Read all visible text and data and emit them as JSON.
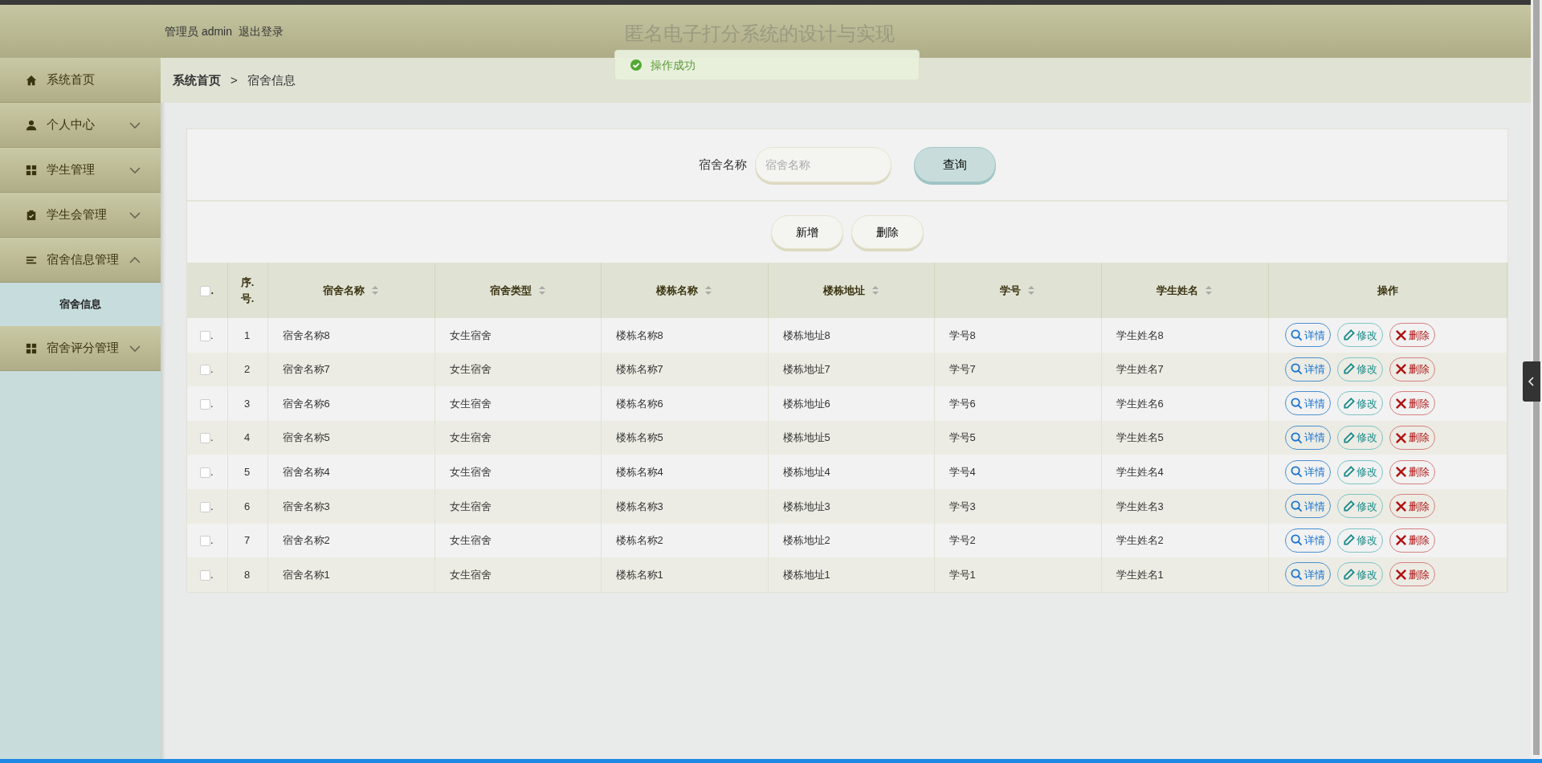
{
  "header": {
    "role": "管理员",
    "username": "admin",
    "logout": "退出登录",
    "title": "匿名电子打分系统的设计与实现"
  },
  "toast": {
    "kind": "success",
    "text": "操作成功"
  },
  "sidebar": {
    "items": [
      {
        "label": "系统首页",
        "kind": "link"
      },
      {
        "label": "个人中心",
        "kind": "menu",
        "expanded": false
      },
      {
        "label": "学生管理",
        "kind": "menu",
        "expanded": false
      },
      {
        "label": "学生会管理",
        "kind": "menu",
        "expanded": false
      },
      {
        "label": "宿舍信息管理",
        "kind": "menu",
        "expanded": true,
        "children": [
          {
            "label": "宿舍信息",
            "selected": true
          }
        ]
      },
      {
        "label": "宿舍评分管理",
        "kind": "menu",
        "expanded": false
      }
    ]
  },
  "breadcrumb": {
    "items": [
      "系统首页",
      "宿舍信息"
    ],
    "separator": ">"
  },
  "search": {
    "label": "宿舍名称",
    "placeholder": "宿舍名称",
    "button": "查询"
  },
  "actions": [
    "新增",
    "删除"
  ],
  "table": {
    "checkbox_suffix": ".",
    "all_checked": false,
    "columns": [
      {
        "label": "序.\n号.",
        "sortable": false
      },
      {
        "label": "宿舍名称",
        "sortable": true
      },
      {
        "label": "宿舍类型",
        "sortable": true
      },
      {
        "label": "楼栋名称",
        "sortable": true
      },
      {
        "label": "楼栋地址",
        "sortable": true
      },
      {
        "label": "学号",
        "sortable": true
      },
      {
        "label": "学生姓名",
        "sortable": true
      },
      {
        "label": "操作",
        "sortable": false
      }
    ],
    "rows": [
      {
        "checked": false,
        "cells": [
          "1",
          "宿舍名称8",
          "女生宿舍",
          "楼栋名称8",
          "楼栋地址8",
          "学号8",
          "学生姓名8"
        ],
        "buttons": [
          {
            "kind": "detail",
            "label": "详情"
          },
          {
            "kind": "edit",
            "label": "修改"
          },
          {
            "kind": "delete",
            "label": "删除"
          }
        ]
      },
      {
        "checked": false,
        "cells": [
          "2",
          "宿舍名称7",
          "女生宿舍",
          "楼栋名称7",
          "楼栋地址7",
          "学号7",
          "学生姓名7"
        ],
        "buttons": [
          {
            "kind": "detail",
            "label": "详情"
          },
          {
            "kind": "edit",
            "label": "修改"
          },
          {
            "kind": "delete",
            "label": "删除"
          }
        ]
      },
      {
        "checked": false,
        "cells": [
          "3",
          "宿舍名称6",
          "女生宿舍",
          "楼栋名称6",
          "楼栋地址6",
          "学号6",
          "学生姓名6"
        ],
        "buttons": [
          {
            "kind": "detail",
            "label": "详情"
          },
          {
            "kind": "edit",
            "label": "修改"
          },
          {
            "kind": "delete",
            "label": "删除"
          }
        ]
      },
      {
        "checked": false,
        "cells": [
          "4",
          "宿舍名称5",
          "女生宿舍",
          "楼栋名称5",
          "楼栋地址5",
          "学号5",
          "学生姓名5"
        ],
        "buttons": [
          {
            "kind": "detail",
            "label": "详情"
          },
          {
            "kind": "edit",
            "label": "修改"
          },
          {
            "kind": "delete",
            "label": "删除"
          }
        ]
      },
      {
        "checked": false,
        "cells": [
          "5",
          "宿舍名称4",
          "女生宿舍",
          "楼栋名称4",
          "楼栋地址4",
          "学号4",
          "学生姓名4"
        ],
        "buttons": [
          {
            "kind": "detail",
            "label": "详情"
          },
          {
            "kind": "edit",
            "label": "修改"
          },
          {
            "kind": "delete",
            "label": "删除"
          }
        ]
      },
      {
        "checked": false,
        "cells": [
          "6",
          "宿舍名称3",
          "女生宿舍",
          "楼栋名称3",
          "楼栋地址3",
          "学号3",
          "学生姓名3"
        ],
        "buttons": [
          {
            "kind": "detail",
            "label": "详情"
          },
          {
            "kind": "edit",
            "label": "修改"
          },
          {
            "kind": "delete",
            "label": "删除"
          }
        ]
      },
      {
        "checked": false,
        "cells": [
          "7",
          "宿舍名称2",
          "女生宿舍",
          "楼栋名称2",
          "楼栋地址2",
          "学号2",
          "学生姓名2"
        ],
        "buttons": [
          {
            "kind": "detail",
            "label": "详情"
          },
          {
            "kind": "edit",
            "label": "修改"
          },
          {
            "kind": "delete",
            "label": "删除"
          }
        ]
      },
      {
        "checked": false,
        "cells": [
          "8",
          "宿舍名称1",
          "女生宿舍",
          "楼栋名称1",
          "楼栋地址1",
          "学号1",
          "学生姓名1"
        ],
        "buttons": [
          {
            "kind": "detail",
            "label": "详情"
          },
          {
            "kind": "edit",
            "label": "修改"
          },
          {
            "kind": "delete",
            "label": "删除"
          }
        ]
      }
    ]
  }
}
